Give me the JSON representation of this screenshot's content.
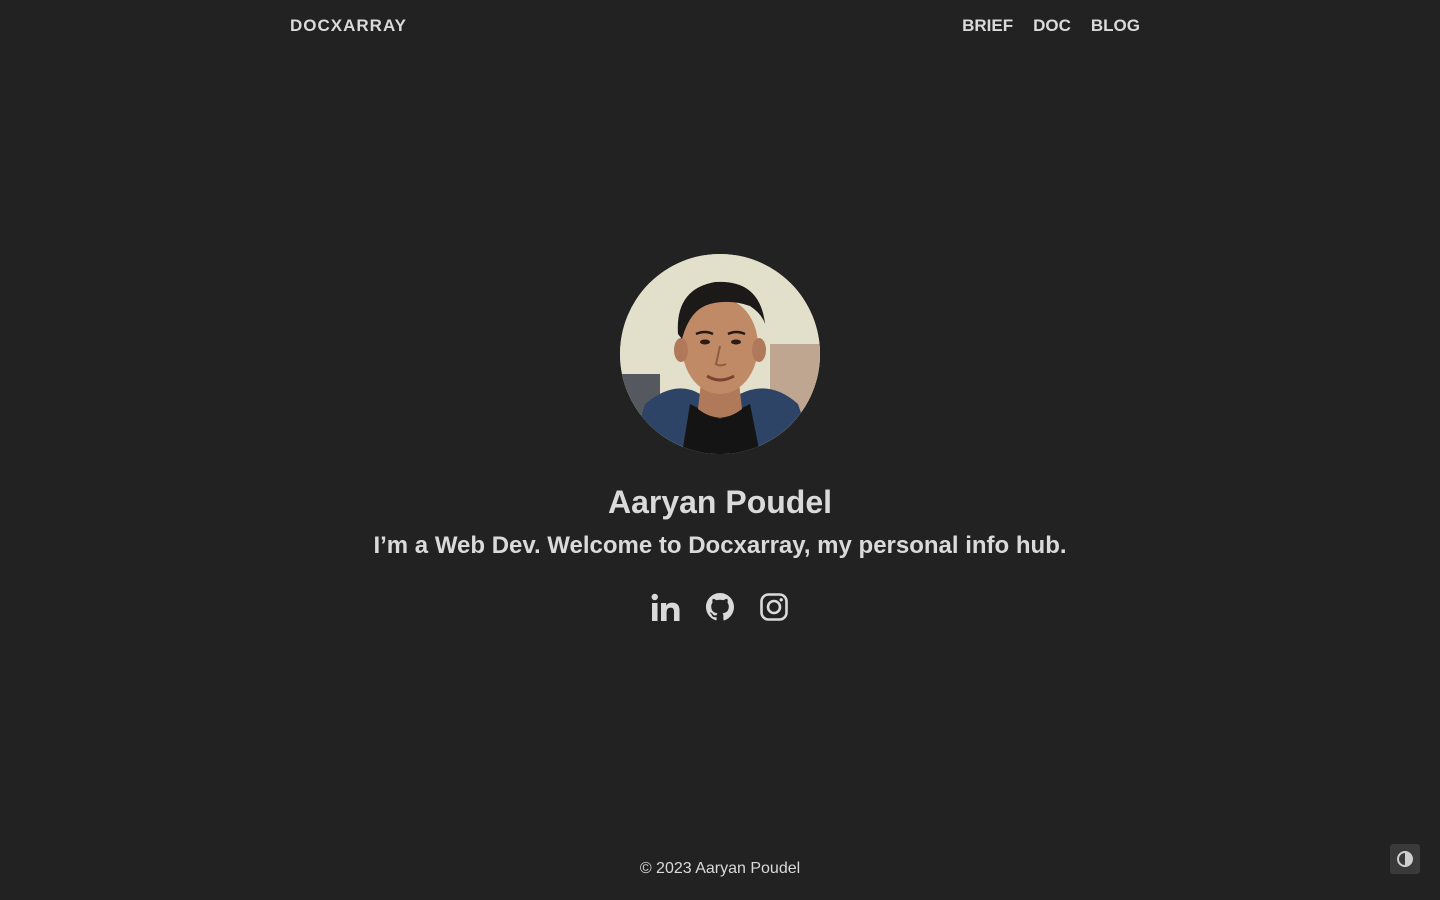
{
  "header": {
    "brand": "DOCXARRAY",
    "nav": [
      {
        "label": "BRIEF"
      },
      {
        "label": "DOC"
      },
      {
        "label": "BLOG"
      }
    ]
  },
  "profile": {
    "name": "Aaryan Poudel",
    "tagline": "I’m a Web Dev. Welcome to Docxarray, my personal info hub.",
    "avatar_icon": "profile-photo"
  },
  "socials": [
    {
      "icon": "linkedin-icon"
    },
    {
      "icon": "github-icon"
    },
    {
      "icon": "instagram-icon"
    }
  ],
  "footer": {
    "copyright": "© 2023 Aaryan Poudel"
  },
  "theme_toggle": {
    "icon": "contrast-icon"
  },
  "colors": {
    "background": "#222222",
    "text": "#dadadb",
    "toggle_bg": "#3a3a3a"
  }
}
